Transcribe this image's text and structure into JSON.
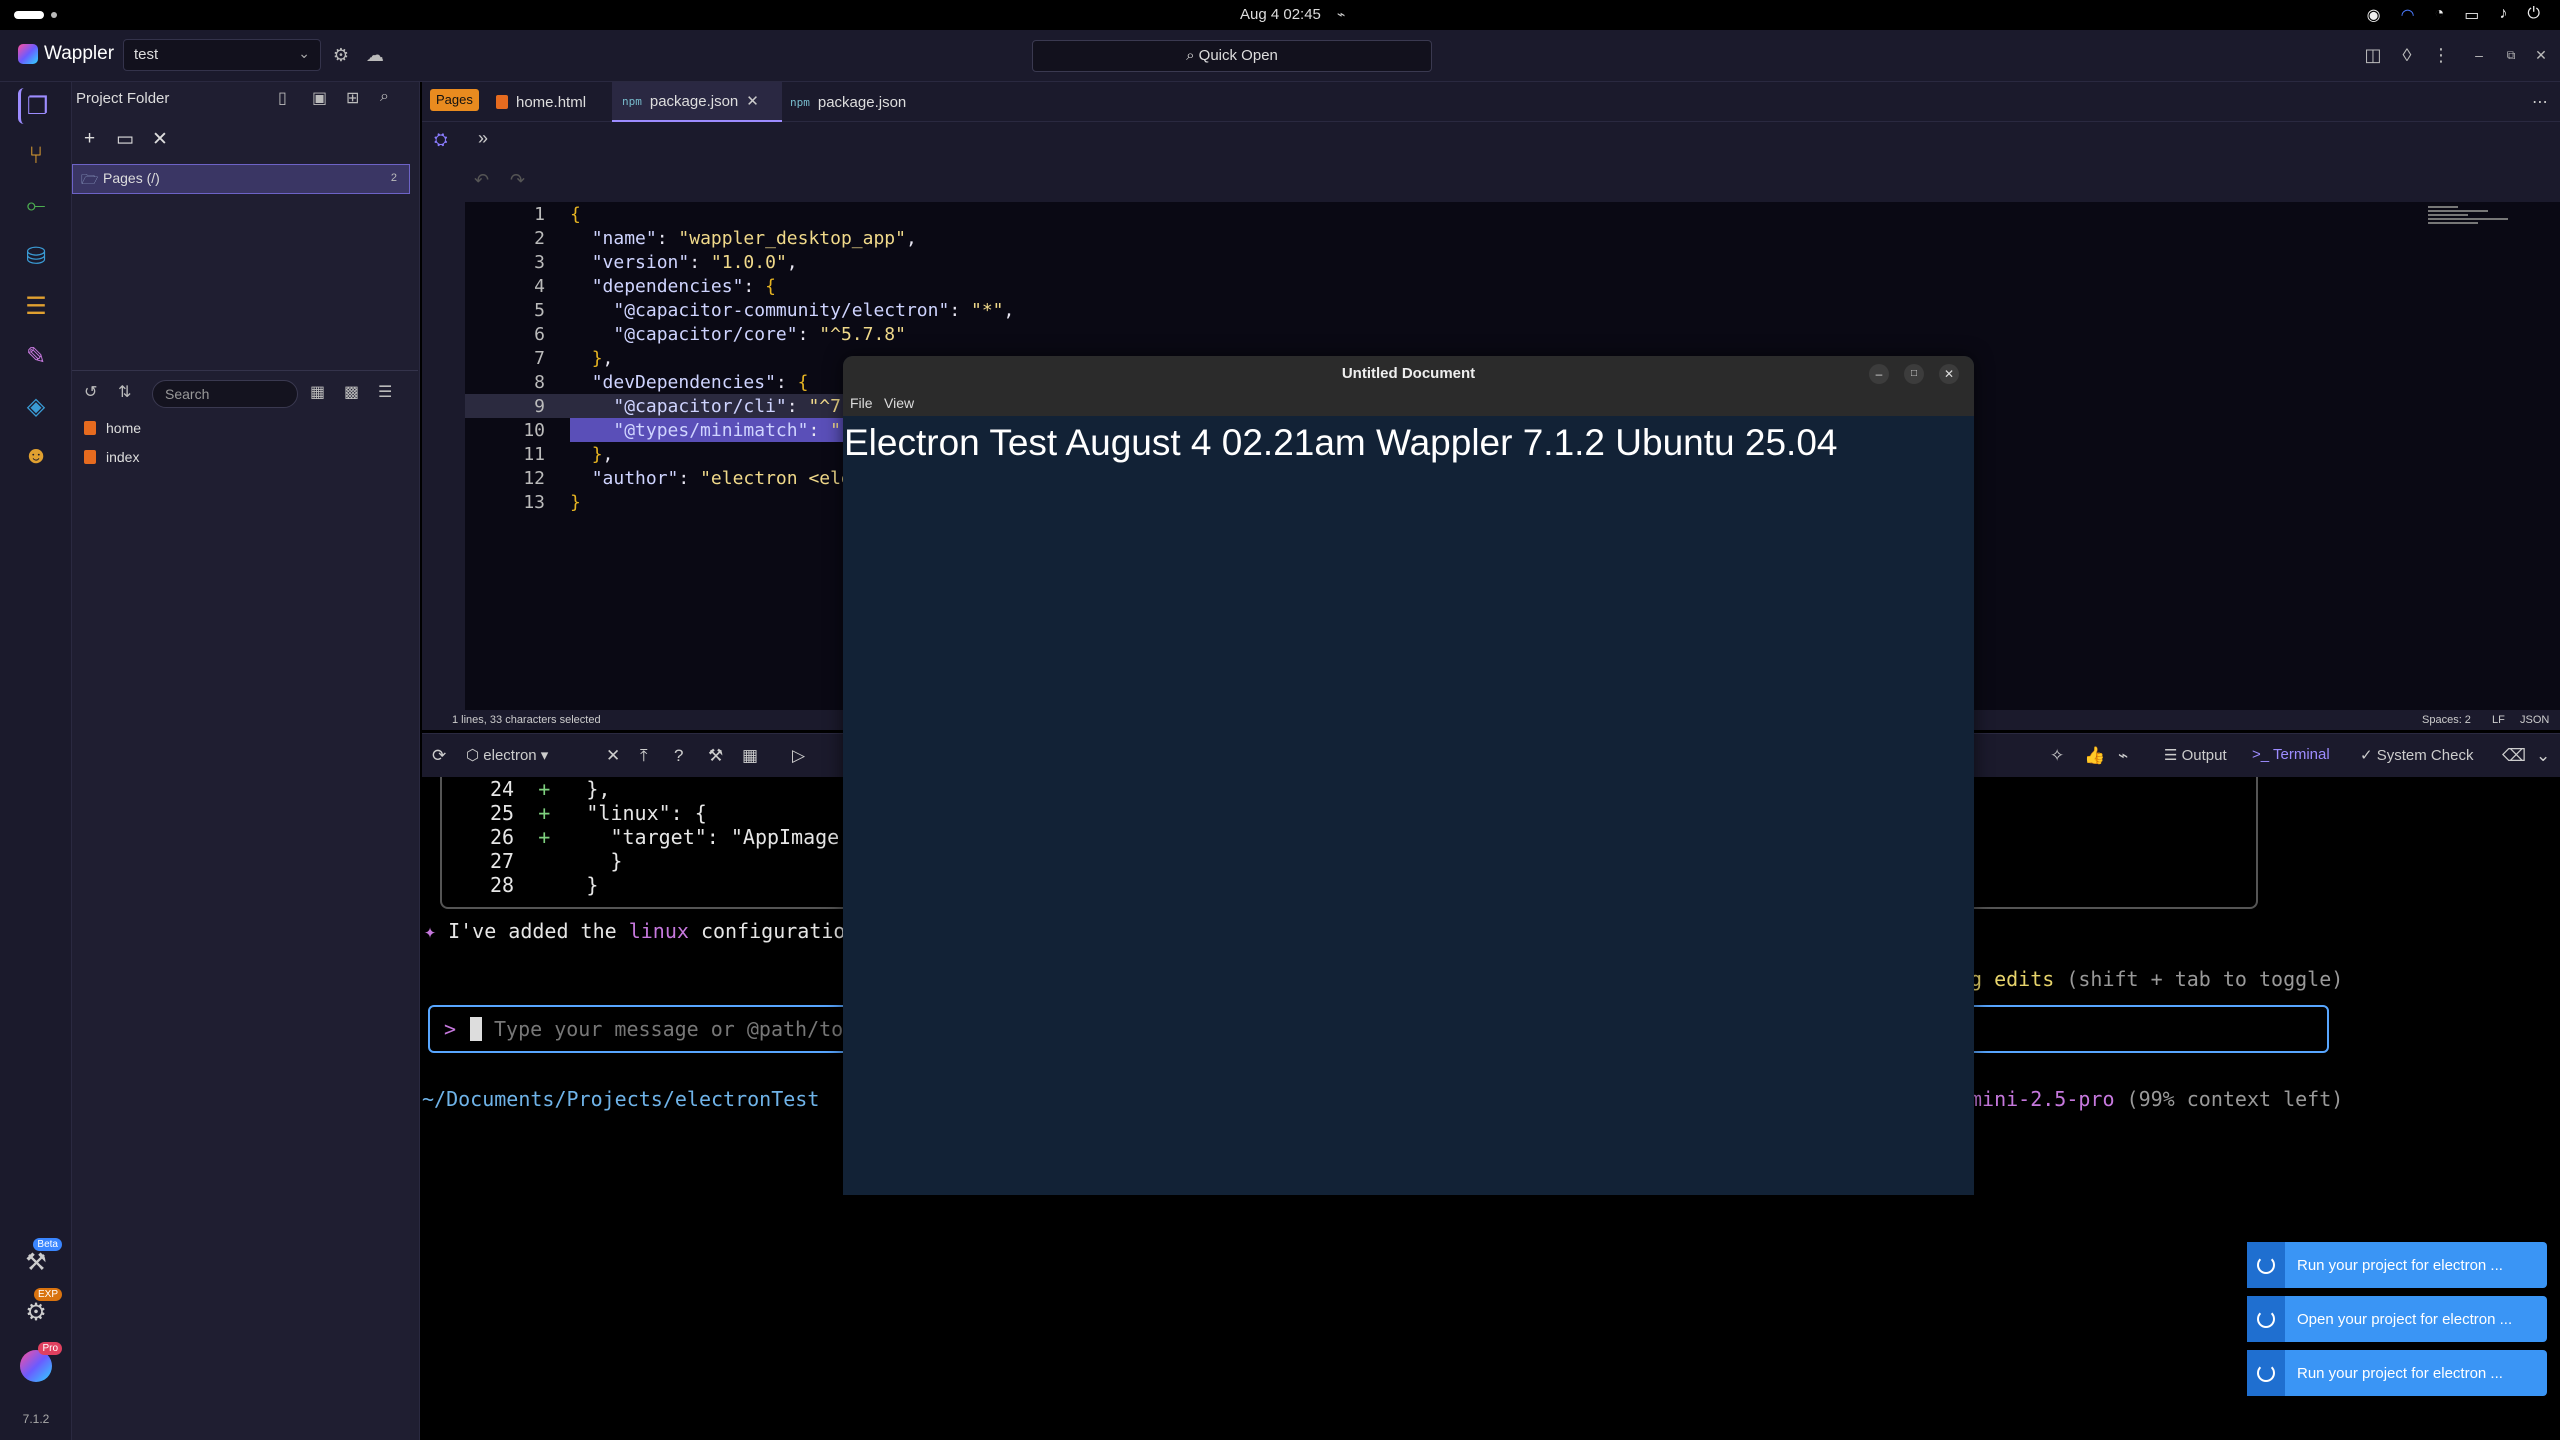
{
  "system": {
    "clock": "Aug 4  02:45"
  },
  "app": {
    "name": "Wappler",
    "project": "test",
    "quick_open": "Quick Open",
    "version": "7.1.2"
  },
  "activity": {
    "badges": {
      "beta": "Beta",
      "exp": "EXP",
      "pro": "Pro"
    }
  },
  "sidebar": {
    "title": "Project Folder",
    "pages_folder": "Pages (/)",
    "pages_count": "2",
    "search_placeholder": "Search",
    "files": [
      "home",
      "index"
    ]
  },
  "tabs": {
    "pages_badge": "Pages",
    "items": [
      {
        "label": "home.html",
        "icon": "html-file-icon"
      },
      {
        "label": "package.json",
        "icon": "json-file-icon",
        "active": true
      },
      {
        "label": "package.json",
        "icon": "json-file-icon"
      }
    ]
  },
  "editor": {
    "line_numbers": [
      "1",
      "2",
      "3",
      "4",
      "5",
      "6",
      "7",
      "8",
      "9",
      "10",
      "11",
      "12",
      "13"
    ],
    "status_left": "1 lines, 33 characters selected",
    "status_spaces": "Spaces: 2",
    "status_eol": "LF",
    "status_lang": "JSON"
  },
  "panel": {
    "target": "electron",
    "output": "Output",
    "terminal": "Terminal",
    "system_check": "System Check"
  },
  "terminal": {
    "diff_lines": [
      {
        "num": "24",
        "mark": "+",
        "text": "  },"
      },
      {
        "num": "25",
        "mark": "+",
        "text": "  \"linux\": {"
      },
      {
        "num": "26",
        "mark": "+",
        "text": "    \"target\": \"AppImage"
      },
      {
        "num": "27",
        "mark": "",
        "text": "    }"
      },
      {
        "num": "28",
        "mark": "",
        "text": "  }"
      }
    ],
    "msg_prefix": "I've added the ",
    "msg_highlight": "linux",
    "msg_suffix": " configuration",
    "hint_tail": "g edits",
    "hint_paren": " (shift + tab to toggle)",
    "prompt_char": ">",
    "input_placeholder": "Type your message or @path/to/",
    "cwd": "~/Documents/Projects/electronTest",
    "model": "mini-2.5-pro",
    "context": " (99% context left)"
  },
  "toasts": [
    "Run your project for electron ...",
    "Open your project for electron ...",
    "Run your project for electron ..."
  ],
  "electron_window": {
    "title": "Untitled Document",
    "menu_file": "File",
    "menu_view": "View",
    "heading": "Electron Test August 4 02.21am Wappler 7.1.2 Ubuntu 25.04"
  }
}
